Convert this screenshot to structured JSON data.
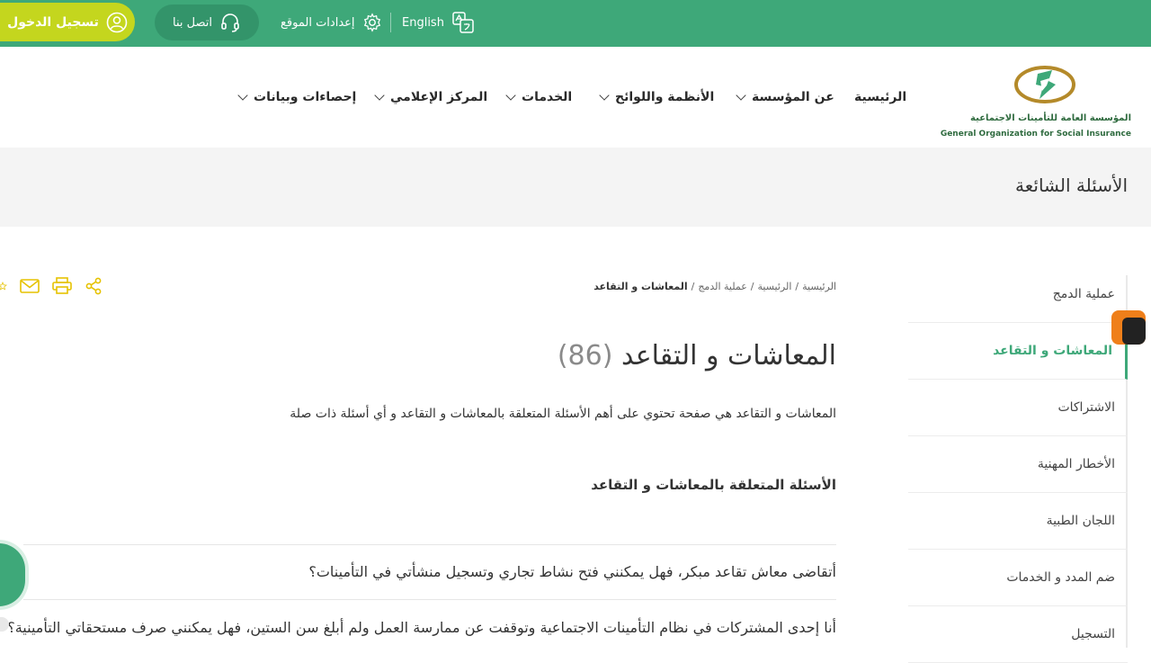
{
  "topbar": {
    "login_label": "تسجيل الدخول",
    "contact_label": "اتصل بنا",
    "settings_label": "إعدادات الموقع",
    "language_label": "English"
  },
  "logo": {
    "arabic_name": "المؤسسة العامة للتأمينات الاجتماعية",
    "english_name": "General Organization for Social Insurance"
  },
  "nav": {
    "home": "الرئيسية",
    "about": "عن المؤسسة",
    "regulations": "الأنظمة واللوائح",
    "services": "الخدمات",
    "media": "المركز الإعلامي",
    "stats": "إحصاءات وبيانات"
  },
  "page_title": "الأسئلة الشائعة",
  "sidebar": {
    "items": [
      {
        "label": "عملية الدمج"
      },
      {
        "label": "المعاشات و التقاعد"
      },
      {
        "label": "الاشتراكات"
      },
      {
        "label": "الأخطار المهنية"
      },
      {
        "label": "اللجان الطبية"
      },
      {
        "label": "ضم المدد و الخدمات"
      },
      {
        "label": "التسجيل"
      }
    ]
  },
  "breadcrumb": {
    "item1": "الرئيسية",
    "item2": "الرئيسية",
    "item3": "عملية الدمج",
    "current": "المعاشات و التقاعد",
    "separator": "/"
  },
  "main": {
    "title": "المعاشات و التقاعد",
    "count": "(86)",
    "intro": "المعاشات و التقاعد هي صفحة تحتوي على أهم الأسئلة المتعلقة بالمعاشات و التقاعد و أي أسئلة ذات صلة",
    "section_heading": "الأسئلة المتعلقة بالمعاشات و التقاعد",
    "questions": [
      {
        "text": "أتقاضى معاش تقاعد مبكر، فهل يمكنني فتح نشاط تجاري وتسجيل منشأتي في التأمينات؟"
      },
      {
        "text": "أنا إحدى المشتركات في نظام التأمينات الاجتماعية وتوقفت عن ممارسة العمل ولم أبلغ سن الستين، فهل يمكنني صرف مستحقاتي التأمينية؟"
      }
    ]
  },
  "colors": {
    "brand_green": "#3ea879",
    "login_lime": "#c4d61e",
    "tool_icon_yellow": "#e6c200"
  }
}
